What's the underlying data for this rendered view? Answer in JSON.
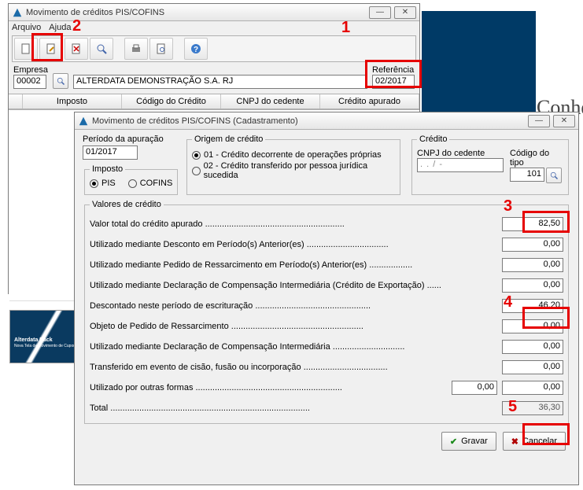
{
  "main_window": {
    "title": "Movimento de créditos PIS/COFINS",
    "menu": {
      "arquivo": "Arquivo",
      "ajuda": "Ajuda"
    },
    "empresa_label": "Empresa",
    "empresa_code": "00002",
    "empresa_name": "ALTERDATA DEMONSTRAÇÃO S.A. RJ",
    "referencia_label": "Referência",
    "referencia_value": "02/2017",
    "headers": {
      "imposto": "Imposto",
      "codigo": "Código do Crédito",
      "cnpj": "CNPJ do cedente",
      "apurado": "Crédito apurado"
    }
  },
  "side": {
    "conhe": "Conhe",
    "thumb_title": "Alterdata Pack",
    "thumb_sub": "Nova Tela de Movimento de Cupom Fiscal"
  },
  "annotations": {
    "a1": "1",
    "a2": "2",
    "a3": "3",
    "a4": "4",
    "a5": "5"
  },
  "modal": {
    "title": "Movimento de créditos PIS/COFINS (Cadastramento)",
    "periodo": {
      "label": "Período da apuração",
      "value": "01/2017"
    },
    "imposto": {
      "legend": "Imposto",
      "pis": "PIS",
      "cofins": "COFINS"
    },
    "origem": {
      "legend": "Origem de crédito",
      "op1": "01 - Crédito decorrente de operações próprias",
      "op2": "02 - Crédito transferido por pessoa jurídica sucedida"
    },
    "credito": {
      "legend": "Crédito",
      "cnpj_label": "CNPJ do cedente",
      "cnpj_mask": "  .   .   /    -",
      "codigo_label": "Código do tipo",
      "codigo_value": "101"
    },
    "valores": {
      "legend": "Valores de crédito",
      "rows": [
        {
          "label": "Valor total do crédito apurado",
          "value": "82,50"
        },
        {
          "label": "Utilizado mediante Desconto em Período(s) Anterior(es)",
          "value": "0,00"
        },
        {
          "label": "Utilizado mediante Pedido de Ressarcimento em  Período(s) Anterior(es)",
          "value": "0,00"
        },
        {
          "label": "Utilizado mediante Declaração de Compensação Intermediária (Crédito de Exportação)",
          "value": "0,00"
        },
        {
          "label": "Descontado neste período de escrituração",
          "value": "46,20"
        },
        {
          "label": "Objeto de Pedido de Ressarcimento",
          "value": "0,00"
        },
        {
          "label": "Utilizado mediante Declaração de Compensação Intermediária",
          "value": "0,00"
        },
        {
          "label": "Transferido em evento de cisão, fusão ou incorporação",
          "value": "0,00"
        },
        {
          "label": "Utilizado por outras formas",
          "value": "0,00",
          "extra": "0,00"
        },
        {
          "label": "Total",
          "value": "36,30",
          "readonly": true
        }
      ]
    },
    "buttons": {
      "gravar": "Gravar",
      "cancelar": "Cancelar"
    }
  }
}
